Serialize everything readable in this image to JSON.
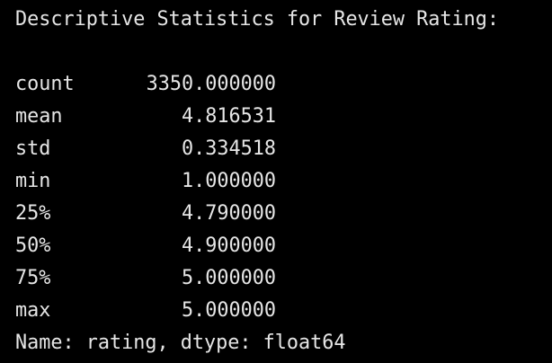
{
  "output": {
    "heading": "Descriptive Statistics for Review Rating:",
    "stats": [
      {
        "name": "count",
        "value": "3350.000000"
      },
      {
        "name": "mean",
        "value": "4.816531"
      },
      {
        "name": "std",
        "value": "0.334518"
      },
      {
        "name": "min",
        "value": "1.000000"
      },
      {
        "name": "25%",
        "value": "4.790000"
      },
      {
        "name": "50%",
        "value": "4.900000"
      },
      {
        "name": "75%",
        "value": "5.000000"
      },
      {
        "name": "max",
        "value": "5.000000"
      }
    ],
    "footer": "Name: rating, dtype: float64"
  },
  "colors": {
    "background": "#000000",
    "text": "#e6e6e6"
  }
}
